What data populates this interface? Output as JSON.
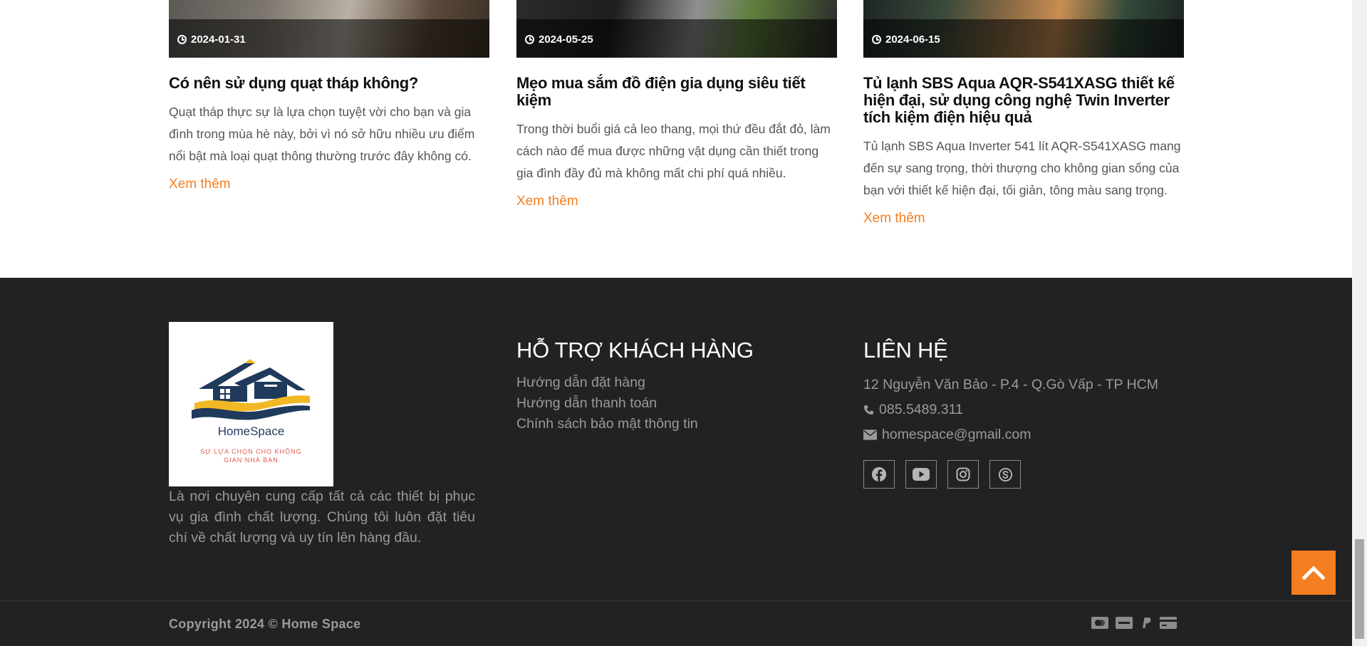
{
  "posts": [
    {
      "date": "2024-01-31",
      "title": "Có nên sử dụng quạt tháp không?",
      "excerpt": "Quạt tháp thực sự là lựa chọn tuyệt vời cho bạn và gia đình trong mùa hè này, bởi vì nó sở hữu nhiều ưu điểm nổi bật mà loại quạt thông thường trước đây không có.",
      "more": "Xem thêm"
    },
    {
      "date": "2024-05-25",
      "title": "Mẹo mua sắm đồ điện gia dụng siêu tiết kiệm",
      "excerpt": "Trong thời buổi giá cả leo thang, mọi thứ đều đắt đỏ, làm cách nào để mua được những vật dụng cần thiết trong gia đình đầy đủ mà không mất chi phí quá nhiều.",
      "more": "Xem thêm"
    },
    {
      "date": "2024-06-15",
      "title": "Tủ lạnh SBS Aqua AQR-S541XASG thiết kế hiện đại, sử dụng công nghệ Twin Inverter tích kiệm điện hiệu quả",
      "excerpt": "Tủ lạnh SBS Aqua Inverter 541 lít AQR-S541XASG mang đến sự sang trọng, thời thượng cho không gian sống của bạn với thiết kế hiện đại, tối giản, tông màu sang trọng.",
      "more": "Xem thêm"
    }
  ],
  "footer": {
    "logo": {
      "name": "HomeSpace",
      "slogan": "SỰ LỰA CHỌN CHO KHÔNG GIAN NHÀ BẠN"
    },
    "about": "Là nơi chuyên cung cấp tất cả các thiết bị phục vụ gia đình chất lượng. Chúng tôi luôn đặt tiêu chí về chất lượng và uy tín lên hàng đầu.",
    "support": {
      "title": "HỖ TRỢ KHÁCH HÀNG",
      "links": [
        "Hướng dẫn đặt hàng",
        "Hướng dẫn thanh toán",
        "Chính sách bảo mật thông tin"
      ]
    },
    "contact": {
      "title": "LIÊN HỆ",
      "address": "12 Nguyễn Văn Bảo - P.4 - Q.Gò Vấp - TP HCM",
      "phone": "085.5489.311",
      "email": "homespace@gmail.com"
    },
    "socials": [
      "facebook-icon",
      "youtube-icon",
      "instagram-icon",
      "skype-icon"
    ],
    "copyright": "Copyright 2024 © Home Space",
    "payments": [
      "mastercard-icon",
      "visa-icon",
      "paypal-icon",
      "card-icon"
    ]
  },
  "colors": {
    "accent": "#f57e20",
    "footer_bg": "#222222",
    "muted_text": "#9a9a9a"
  }
}
